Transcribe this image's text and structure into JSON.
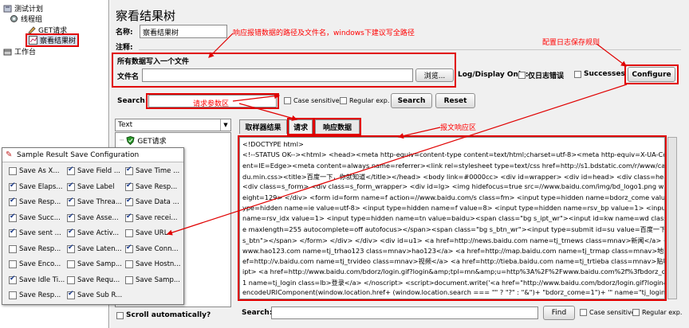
{
  "tree": {
    "test_plan": "测试计划",
    "thread_group": "线程组",
    "get_request": "GET请求",
    "results_tree": "察看结果树",
    "workbench": "工作台"
  },
  "header": {
    "title": "察看结果树",
    "name_label": "名称:",
    "name_value": "察看结果树",
    "comment_label": "注释:"
  },
  "file_section": {
    "heading": "所有数据写入一个文件",
    "file_label": "文件名",
    "browse_label": "浏览...",
    "log_display_label": "Log/Display Only:",
    "errors_only_label": "仅日志错误",
    "successes_label": "Successes",
    "configure_label": "Configure"
  },
  "search": {
    "label": "Search:",
    "case_sensitive_label": "Case sensitive",
    "regex_label": "Regular exp.",
    "search_button": "Search",
    "reset_button": "Reset"
  },
  "renderer": {
    "selected": "Text",
    "tree_item": "GET请求",
    "scroll_label": "Scroll automatically?"
  },
  "tabs": [
    "取样器结果",
    "请求",
    "响应数据"
  ],
  "response_lines": [
    "<!DOCTYPE html>",
    "<!--STATUS OK--><html> <head><meta http-equiv=content-type content=text/html;charset=utf-8><meta http-equiv=X-UA-Compatible co",
    "ent=IE=Edge><meta content=always name=referrer><link rel=stylesheet type=text/css href=http://s1.bdstatic.com/r/www/cache/bdorz/b",
    "du.min.css><title>百度一下，你就知道</title></head> <body link=#0000cc> <div id=wrapper> <div id=head> <div class=head_wrapper",
    "<div class=s_form> <div class=s_form_wrapper> <div id=lg> <img hidefocus=true src=//www.baidu.com/img/bd_logo1.png width=27",
    "eight=129> </div> <form id=form name=f action=//www.baidu.com/s class=fm> <input type=hidden name=bdorz_come value=1> <inpu",
    "ype=hidden name=ie value=utf-8> <input type=hidden name=f value=8> <input type=hidden name=rsv_bp value=1> <input type=hidde",
    "name=rsv_idx value=1> <input type=hidden name=tn value=baidu><span class=\"bg s_ipt_wr\"><input id=kw name=wd class=s_ipt val",
    "e maxlength=255 autocomplete=off autofocus></span><span class=\"bg s_btn_wr\"><input type=submit id=su value=百度一下 class=",
    "s_btn\"></span> </form> </div> </div> <div id=u1> <a href=http://news.baidu.com name=tj_trnews class=mnav>新闻</a> <a href=h",
    "www.hao123.com name=tj_trhao123 class=mnav>hao123</a> <a href=http://map.baidu.com name=tj_trmap class=mnav>地图</a> <a",
    "ef=http://v.baidu.com name=tj_trvideo class=mnav>视频</a> <a href=http://tieba.baidu.com name=tj_trtieba class=mnav>贴吧</a> <n",
    "ipt> <a href=http://www.baidu.com/bdorz/login.gif?login&amp;tpl=mn&amp;u=http%3A%2F%2Fwww.baidu.com%2f%3fbdorz_come%",
    "1 name=tj_login class=lb>登录</a> </noscript> <script>document.write('<a href=\"http://www.baidu.com/bdorz/login.gif?login&tpl=mn&",
    "encodeURIComponent(window.location.href+ (window.location.search === \"\" ? \"?\" : \"&\")+ \"bdorz_come=1\")+ '\" name=\"tj_login\" clas"
  ],
  "bottom_search": {
    "label": "Search:",
    "find_button": "Find",
    "case_sensitive_label": "Case sensitive",
    "regex_label": "Regular exp."
  },
  "dialog": {
    "title": "Sample Result Save Configuration",
    "options": [
      {
        "label": "Save As X...",
        "checked": false
      },
      {
        "label": "Save Field ...",
        "checked": true
      },
      {
        "label": "Save Time ...",
        "checked": true
      },
      {
        "label": "Save Elaps...",
        "checked": true
      },
      {
        "label": "Save Label",
        "checked": true
      },
      {
        "label": "Save Resp...",
        "checked": true
      },
      {
        "label": "Save Resp...",
        "checked": true
      },
      {
        "label": "Save Threa...",
        "checked": true
      },
      {
        "label": "Save Data ...",
        "checked": true
      },
      {
        "label": "Save Succ...",
        "checked": true
      },
      {
        "label": "Save Asse...",
        "checked": true
      },
      {
        "label": "Save recei...",
        "checked": true
      },
      {
        "label": "Save sent ...",
        "checked": true
      },
      {
        "label": "Save Activ...",
        "checked": true
      },
      {
        "label": "Save URL",
        "checked": false
      },
      {
        "label": "Save Resp...",
        "checked": false
      },
      {
        "label": "Save Laten...",
        "checked": true
      },
      {
        "label": "Save Conn...",
        "checked": true
      },
      {
        "label": "Save Enco...",
        "checked": false
      },
      {
        "label": "Save Samp...",
        "checked": false
      },
      {
        "label": "Save Hostn...",
        "checked": false
      },
      {
        "label": "Save Idle Ti...",
        "checked": true
      },
      {
        "label": "Save Requ...",
        "checked": false
      },
      {
        "label": "Save Samp...",
        "checked": false
      },
      {
        "label": "Save Resp...",
        "checked": false
      },
      {
        "label": "Save Sub R...",
        "checked": true
      }
    ]
  },
  "annotations": {
    "path_note": "响应报错数据的路径及文件名，windows下建议写全路径",
    "log_rule_note": "配置日志保存规则",
    "param_note": "请求参数区",
    "response_note": "报文响应区"
  },
  "colors": {
    "annotation": "#ff0000",
    "check": "#1a3a8a"
  }
}
